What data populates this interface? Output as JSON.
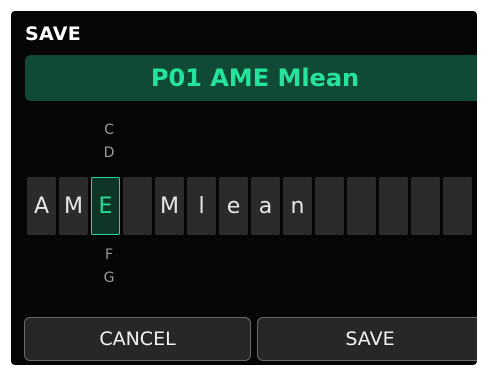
{
  "screen": {
    "title": "SAVE",
    "preset_name": "P01 AME Mlean"
  },
  "editor": {
    "active_index": 2,
    "above_chars": [
      "C",
      "D"
    ],
    "below_chars": [
      "F",
      "G"
    ],
    "characters": [
      "A",
      "M",
      "E",
      "",
      "M",
      "l",
      "e",
      "a",
      "n",
      "",
      "",
      "",
      "",
      ""
    ]
  },
  "buttons": {
    "cancel_label": "CANCEL",
    "save_label": "SAVE"
  },
  "colors": {
    "accent": "#27d896",
    "display_bg": "#104a36",
    "screen_bg": "#060606",
    "cell_bg": "#2b2b2b"
  }
}
